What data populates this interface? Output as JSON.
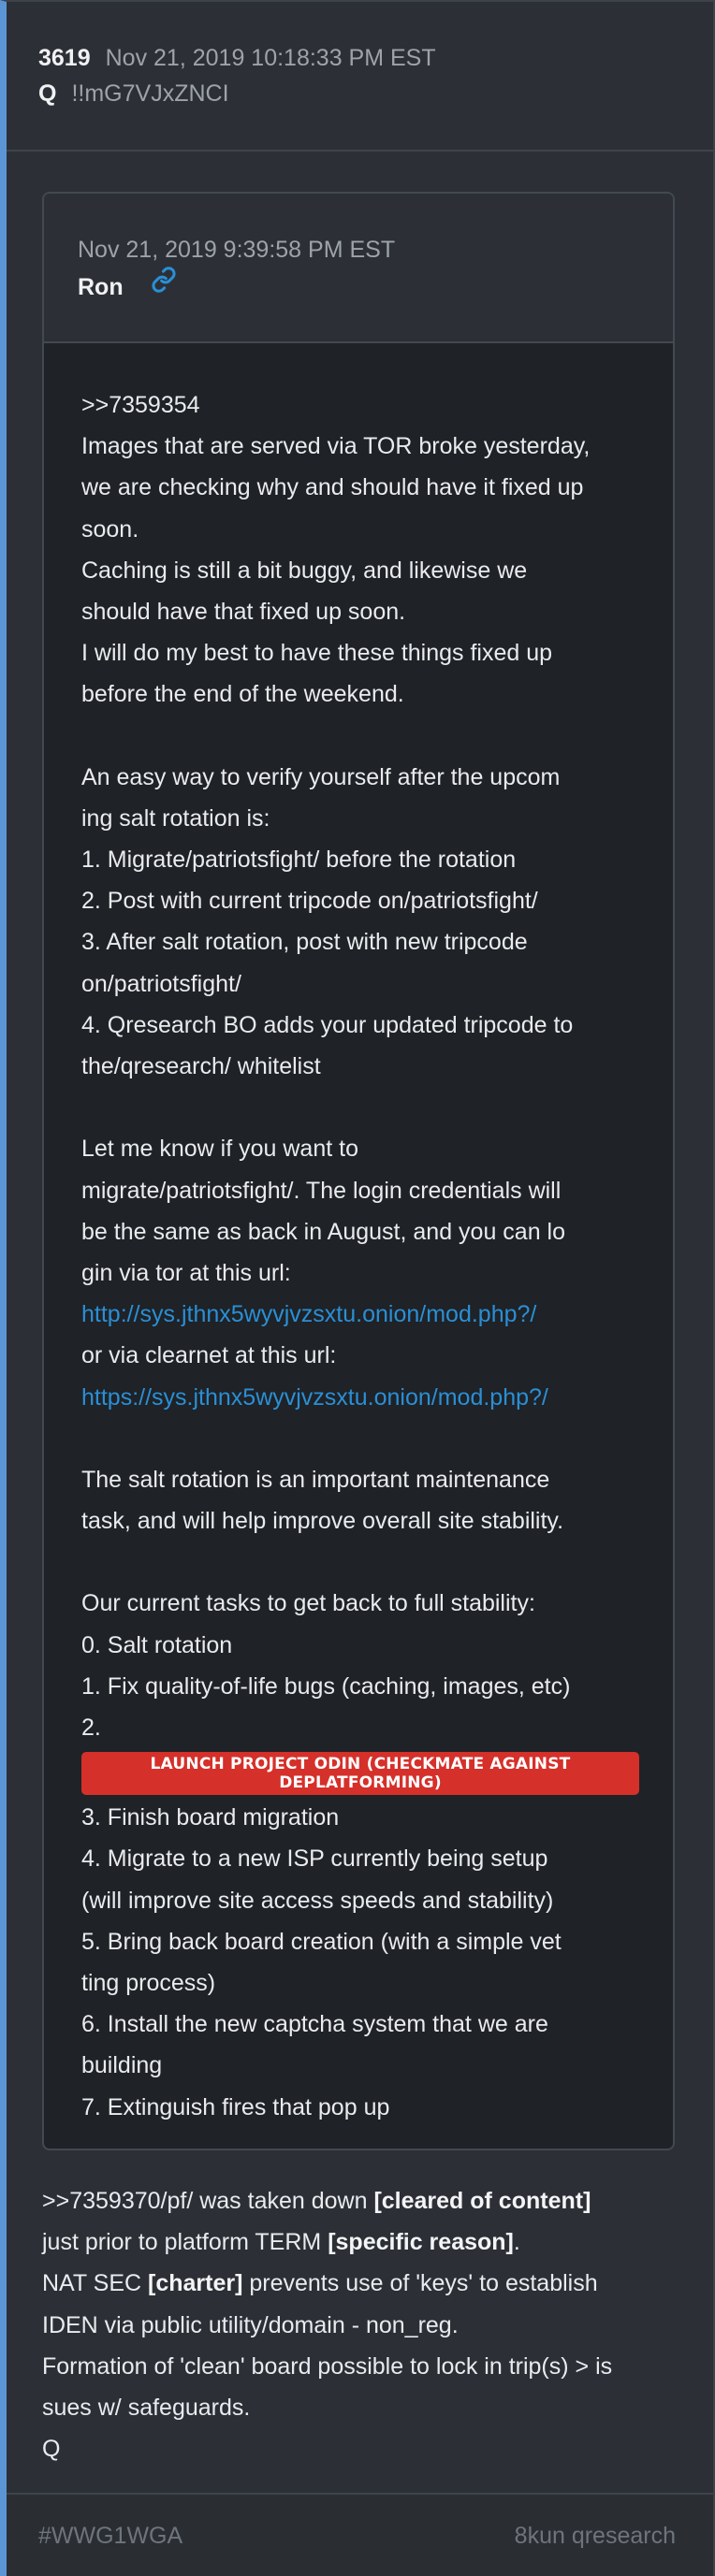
{
  "post": {
    "number": "3619",
    "date": "Nov 21, 2019 10:18:33 PM EST",
    "author": "Q",
    "tripcode": "!!mG7VJxZNCI"
  },
  "quoted_post": {
    "date": "Nov 21, 2019 9:39:58 PM EST",
    "author": "Ron",
    "link_icon": "link-icon",
    "lines_before": [
      ">>7359354",
      "Images that are served via TOR broke yesterday,",
      "we are checking why and should have it fixed up",
      "soon.",
      "Caching is still a bit buggy, and likewise we",
      "should have that fixed up soon.",
      "I will do my best to have these things fixed up",
      "before the end of the weekend.",
      "",
      "An easy way to verify yourself after the upcom",
      "ing salt rotation is:",
      "1. Migrate/patriotsfight/ before the rotation",
      "2. Post with current tripcode on/patriotsfight/",
      "3. After salt rotation, post with new tripcode",
      "on/patriotsfight/",
      "4. Qresearch BO adds your updated tripcode to",
      "the/qresearch/ whitelist",
      "",
      "Let me know if you want to",
      "migrate/patriotsfight/. The login credentials will",
      "be the same as back in August, and you can lo",
      "gin via tor at this url:"
    ],
    "tor_url": "http://sys.jthnx5wyvjvzsxtu.onion/mod.php?/",
    "clearnet_intro": "or via clearnet at this url:",
    "clearnet_url": "https://sys.jthnx5wyvjvzsxtu.onion/mod.php?/",
    "lines_after": [
      "",
      "The salt rotation is an important maintenance",
      "task, and will help improve overall site stability.",
      "",
      "Our current tasks to get back to full stability:",
      "0. Salt rotation",
      "1. Fix quality-of-life bugs (caching, images, etc)",
      "2."
    ],
    "banner": "LAUNCH PROJECT ODIN (CHECKMATE AGAINST DEPLATFORMING)",
    "lines_final": [
      "3. Finish board migration",
      "4. Migrate to a new ISP currently being setup",
      "(will improve site access speeds and stability)",
      "5. Bring back board creation (with a simple vet",
      "ting process)",
      "6. Install the new captcha system that we are",
      "building",
      "7. Extinguish fires that pop up"
    ]
  },
  "message": {
    "l1_a": ">>7359370/pf/ was taken down ",
    "l1_b": "[cleared of content]",
    "l2_a": "just prior to platform TERM ",
    "l2_b": "[specific reason]",
    "l2_c": ".",
    "l3_a": "NAT SEC ",
    "l3_b": "[charter]",
    "l3_c": " prevents use of 'keys' to establish",
    "l4": "IDEN via public utility/domain - non_reg.",
    "l5": "Formation of 'clean' board possible to lock in trip(s) > is",
    "l6": "sues w/ safeguards.",
    "l7": "Q"
  },
  "footer": {
    "hashtag": "#WWG1WGA",
    "source": "8kun qresearch"
  },
  "colors": {
    "accent_bar": "#5b95d6",
    "link": "#2a8fd6",
    "banner": "#d5302a"
  }
}
